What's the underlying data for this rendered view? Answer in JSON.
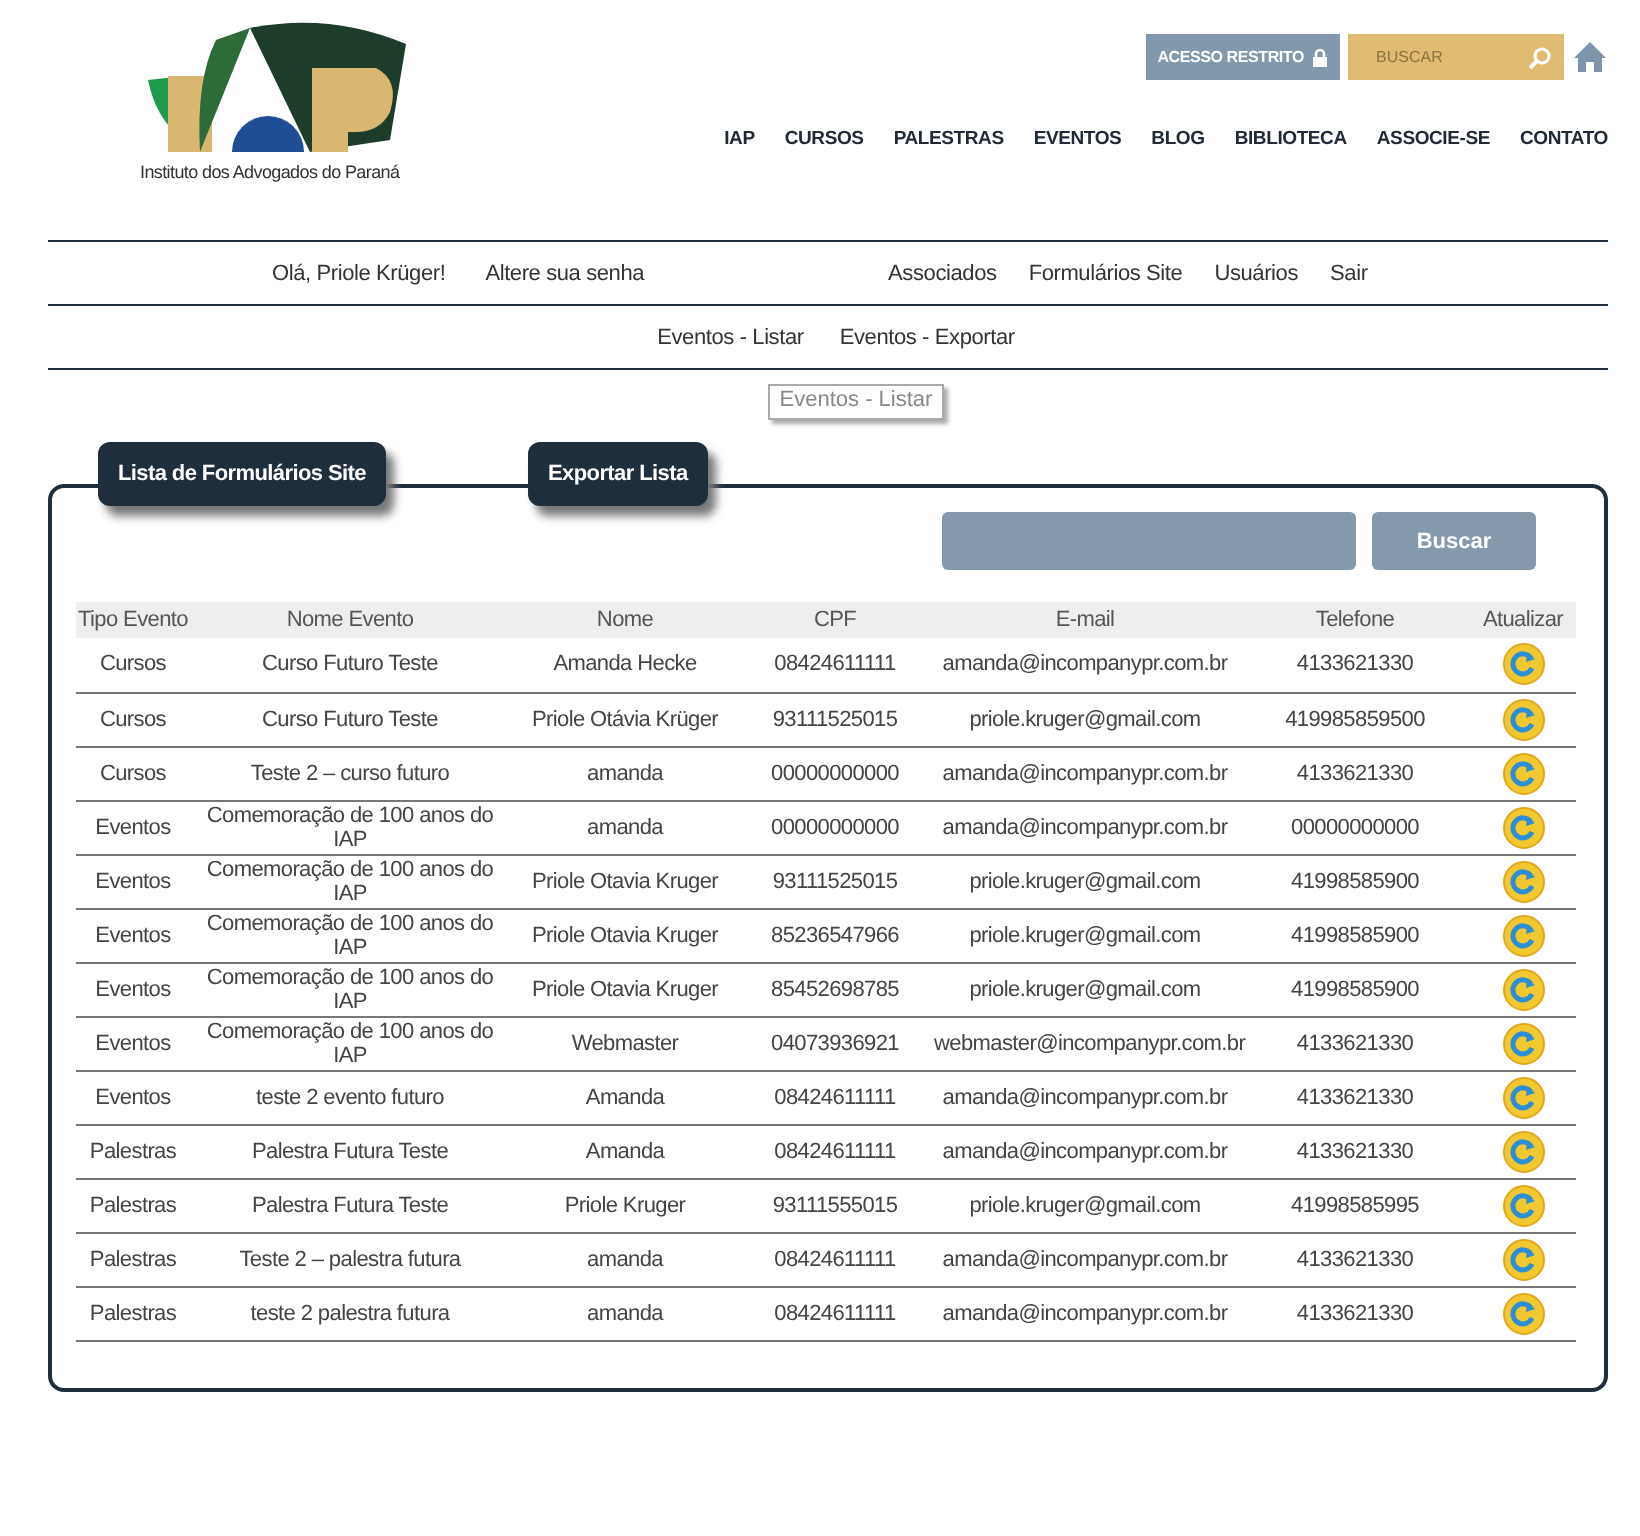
{
  "header": {
    "logo_caption": "Instituto dos Advogados do Paraná",
    "restricted_button": "ACESSO RESTRITO",
    "search": {
      "placeholder": "BUSCAR"
    },
    "nav": [
      "IAP",
      "CURSOS",
      "PALESTRAS",
      "EVENTOS",
      "BLOG",
      "BIBLIOTECA",
      "ASSOCIE-SE",
      "CONTATO"
    ]
  },
  "user_menu": {
    "left": [
      "Olá, Priole Krüger!",
      "Altere sua senha"
    ],
    "right": [
      "Associados",
      "Formulários Site",
      "Usuários",
      "Sair"
    ]
  },
  "submenu": [
    "Eventos - Listar",
    "Eventos - Exportar"
  ],
  "tooltip": "Eventos - Listar",
  "panel": {
    "tabs": [
      "Lista de Formulários Site",
      "Exportar Lista"
    ],
    "search_button": "Buscar",
    "table": {
      "columns": [
        "Tipo Evento",
        "Nome Evento",
        "Nome",
        "CPF",
        "E-mail",
        "Telefone",
        "Atualizar"
      ],
      "rows": [
        [
          "Cursos",
          "Curso Futuro Teste",
          "Amanda Hecke",
          "08424611111",
          "amanda@incompanypr.com.br",
          "4133621330"
        ],
        [
          "Cursos",
          "Curso Futuro Teste",
          "Priole Otávia Krüger",
          "93111525015",
          "priole.kruger@gmail.com",
          "419985859500"
        ],
        [
          "Cursos",
          "Teste 2 – curso futuro",
          "amanda",
          "00000000000",
          "amanda@incompanypr.com.br",
          "4133621330"
        ],
        [
          "Eventos",
          "Comemoração de 100 anos do IAP",
          "amanda",
          "00000000000",
          "amanda@incompanypr.com.br",
          "00000000000"
        ],
        [
          "Eventos",
          "Comemoração de 100 anos do IAP",
          "Priole Otavia Kruger",
          "93111525015",
          "priole.kruger@gmail.com",
          "41998585900"
        ],
        [
          "Eventos",
          "Comemoração de 100 anos do IAP",
          "Priole Otavia Kruger",
          "85236547966",
          "priole.kruger@gmail.com",
          "41998585900"
        ],
        [
          "Eventos",
          "Comemoração de 100 anos do IAP",
          "Priole Otavia Kruger",
          "85452698785",
          "priole.kruger@gmail.com",
          "41998585900"
        ],
        [
          "Eventos",
          "Comemoração de 100 anos do IAP",
          "Webmaster",
          "04073936921",
          "webmaster@incompanypr.com.br",
          "4133621330"
        ],
        [
          "Eventos",
          "teste 2 evento futuro",
          "Amanda",
          "08424611111",
          "amanda@incompanypr.com.br",
          "4133621330"
        ],
        [
          "Palestras",
          "Palestra Futura Teste",
          "Amanda",
          "08424611111",
          "amanda@incompanypr.com.br",
          "4133621330"
        ],
        [
          "Palestras",
          "Palestra Futura Teste",
          "Priole Kruger",
          "93111555015",
          "priole.kruger@gmail.com",
          "41998585995"
        ],
        [
          "Palestras",
          "Teste 2 – palestra futura",
          "amanda",
          "08424611111",
          "amanda@incompanypr.com.br",
          "4133621330"
        ],
        [
          "Palestras",
          "teste 2 palestra futura",
          "amanda",
          "08424611111",
          "amanda@incompanypr.com.br",
          "4133621330"
        ]
      ]
    }
  }
}
